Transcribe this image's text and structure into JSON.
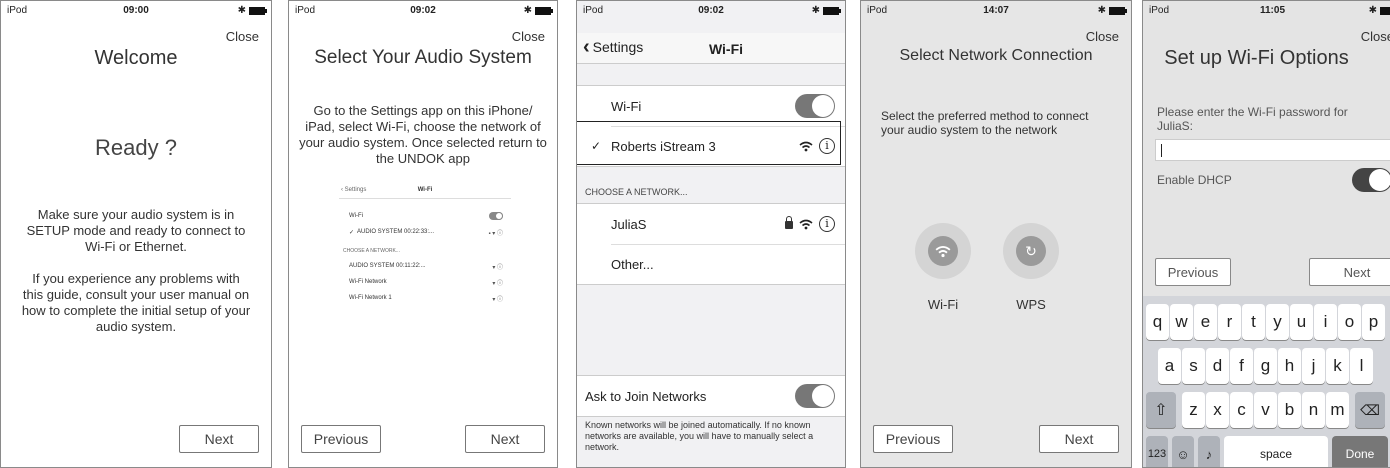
{
  "screens": [
    {
      "status": {
        "carrier": "iPod",
        "time": "09:00"
      },
      "close": "Close",
      "title": "Welcome",
      "heading": "Ready ?",
      "paragraph1": "Make sure your audio system is in SETUP mode and ready to connect to Wi-Fi or Ethernet.",
      "paragraph2": "If you experience any problems with this guide, consult your user manual on how to complete the initial setup of your audio system.",
      "next": "Next"
    },
    {
      "status": {
        "carrier": "iPod",
        "time": "09:02"
      },
      "close": "Close",
      "title": "Select Your Audio System",
      "paragraph": "Go to the Settings app on this iPhone/ iPad, select Wi-Fi, choose the network of your audio system. Once selected return to the UNDOK app",
      "mini": {
        "back": "Settings",
        "title": "Wi-Fi",
        "wifi_label": "Wi-Fi",
        "connected": "AUDIO SYSTEM 00:22:33:...",
        "section": "CHOOSE A NETWORK...",
        "networks": [
          "AUDIO SYSTEM 00:11:22:...",
          "Wi-Fi Network",
          "Wi-Fi Network 1"
        ]
      },
      "previous": "Previous",
      "next": "Next"
    },
    {
      "status": {
        "carrier": "iPod",
        "time": "09:02"
      },
      "back": "Settings",
      "title": "Wi-Fi",
      "wifi_label": "Wi-Fi",
      "connected_network": "Roberts iStream 3",
      "check": "✓",
      "section_header": "CHOOSE A NETWORK...",
      "networks": [
        "JuliaS",
        "Other..."
      ],
      "ask_label": "Ask to Join Networks",
      "ask_note": "Known networks will be joined automatically. If no known networks are available, you will have to manually select a network."
    },
    {
      "status": {
        "carrier": "iPod",
        "time": "14:07"
      },
      "close": "Close",
      "title": "Select Network Connection",
      "paragraph": "Select the preferred method to connect your audio system to the network",
      "option_wifi": "Wi-Fi",
      "option_wps": "WPS",
      "previous": "Previous",
      "next": "Next"
    },
    {
      "status": {
        "carrier": "iPod",
        "time": "11:05"
      },
      "close": "Close",
      "title": "Set up Wi-Fi Options",
      "paragraph": "Please enter the Wi-Fi password for JuliaS:",
      "dhcp_label": "Enable DHCP",
      "previous": "Previous",
      "next": "Next",
      "keyboard": {
        "row1": [
          "q",
          "w",
          "e",
          "r",
          "t",
          "y",
          "u",
          "i",
          "o",
          "p"
        ],
        "row2": [
          "a",
          "s",
          "d",
          "f",
          "g",
          "h",
          "j",
          "k",
          "l"
        ],
        "row3": [
          "z",
          "x",
          "c",
          "v",
          "b",
          "n",
          "m"
        ],
        "numbers": "123",
        "space": "space",
        "done": "Done"
      }
    }
  ]
}
